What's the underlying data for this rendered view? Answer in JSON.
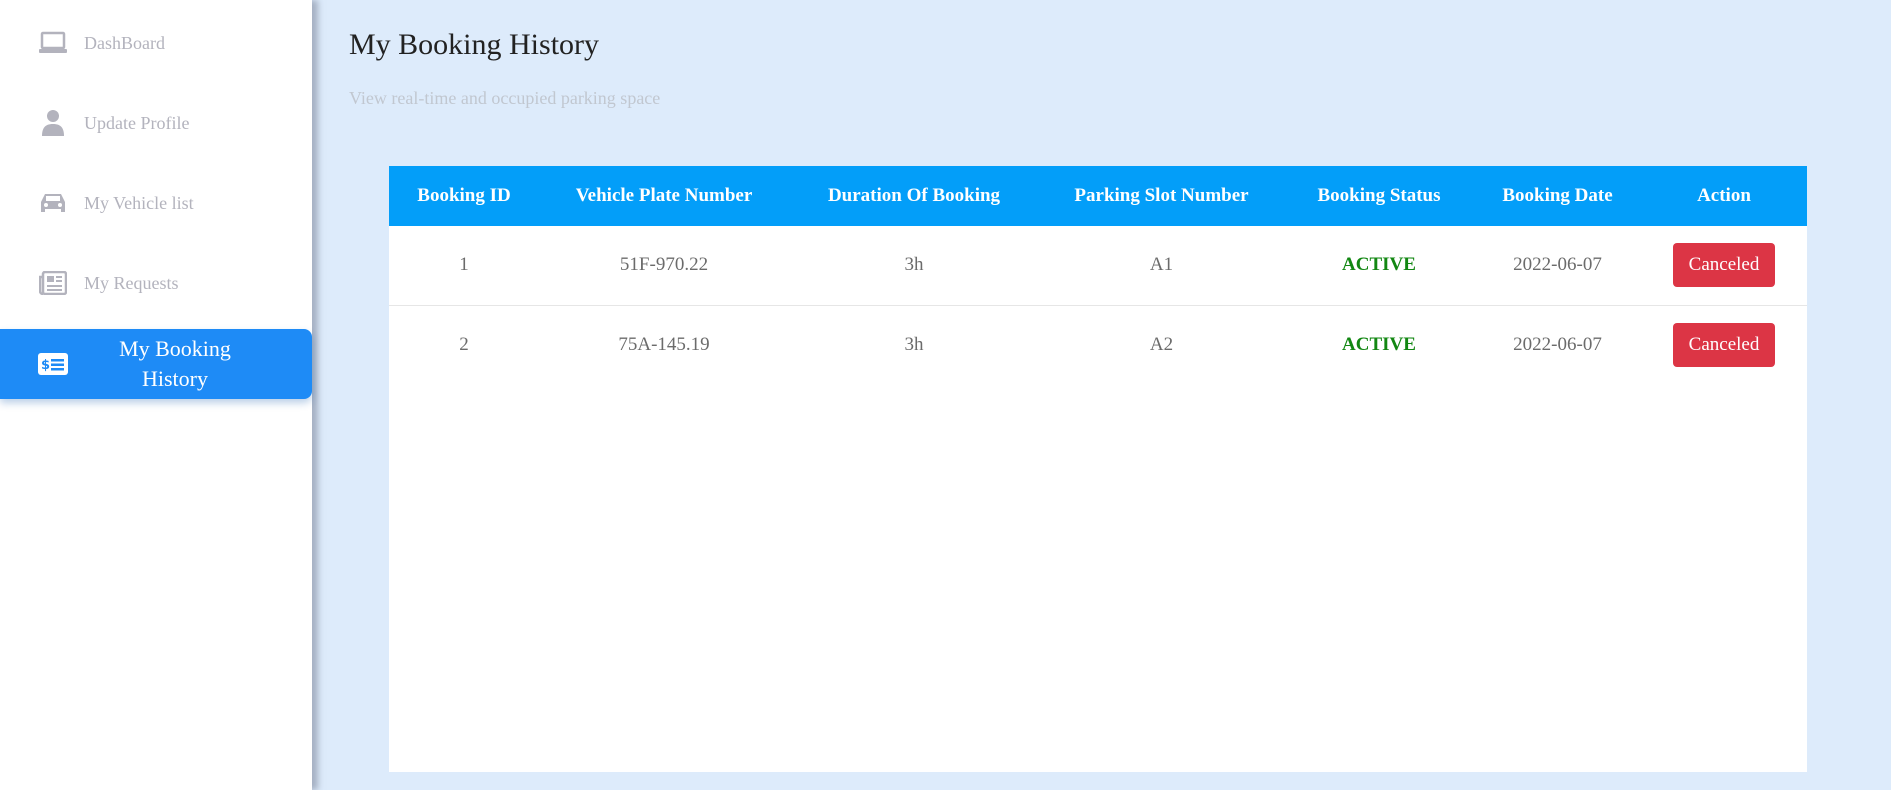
{
  "sidebar": {
    "items": [
      {
        "label": "DashBoard",
        "icon": "laptop-icon"
      },
      {
        "label": "Update Profile",
        "icon": "user-icon"
      },
      {
        "label": "My Vehicle list",
        "icon": "car-icon"
      },
      {
        "label": "My Requests",
        "icon": "newspaper-icon"
      },
      {
        "label": "My Booking History",
        "icon": "money-check-icon"
      }
    ],
    "active_index": 4
  },
  "page": {
    "title": "My Booking History",
    "subtitle": "View real-time and occupied parking space"
  },
  "table": {
    "headers": [
      "Booking ID",
      "Vehicle Plate Number",
      "Duration Of Booking",
      "Parking Slot Number",
      "Booking Status",
      "Booking Date",
      "Action"
    ],
    "rows": [
      {
        "id": "1",
        "plate": "51F-970.22",
        "duration": "3h",
        "slot": "A1",
        "status": "ACTIVE",
        "date": "2022-06-07",
        "action": "Canceled"
      },
      {
        "id": "2",
        "plate": "75A-145.19",
        "duration": "3h",
        "slot": "A2",
        "status": "ACTIVE",
        "date": "2022-06-07",
        "action": "Canceled"
      }
    ]
  },
  "colors": {
    "accent": "#1e8bf6",
    "table_header": "#039ef9",
    "status_active": "#128712",
    "cancel_button": "#dc3545",
    "background": "#ddebfb"
  }
}
